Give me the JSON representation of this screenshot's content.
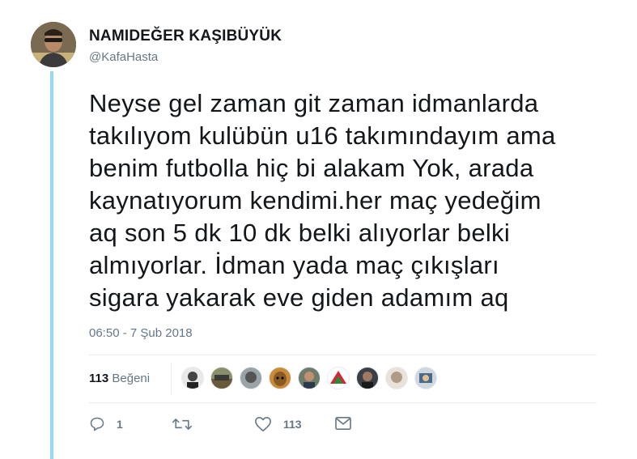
{
  "user": {
    "name": "NAMIDEĞER KAŞIBÜYÜK",
    "handle": "@KafaHasta"
  },
  "tweet": {
    "text": "Neyse gel zaman git zaman idmanlarda\ntakılıyom kulübün u16 takımındayım ama\nbenim futbolla  hiç bi alakam Yok, arada\nkaynatıyorum kendimi.her maç yedeğim\naq son 5 dk 10 dk belki alıyorlar belki\nalmıyorlar. İdman yada maç çıkışları\nsigara yakarak eve giden adamım aq",
    "timestamp": "06:50 - 7 Şub 2018"
  },
  "stats": {
    "likes_count": "113",
    "likes_label": "Beğeni",
    "liker_avatar_count": 9
  },
  "actions": {
    "reply_count": "1",
    "retweet_count": "",
    "like_count": "113"
  },
  "icons": [
    "reply-icon",
    "retweet-icon",
    "like-icon",
    "message-icon"
  ],
  "colors": {
    "thread_line": "#9ad6f5",
    "secondary_text": "#657786",
    "primary_text": "#14171a",
    "divider": "#e6ecf0"
  }
}
